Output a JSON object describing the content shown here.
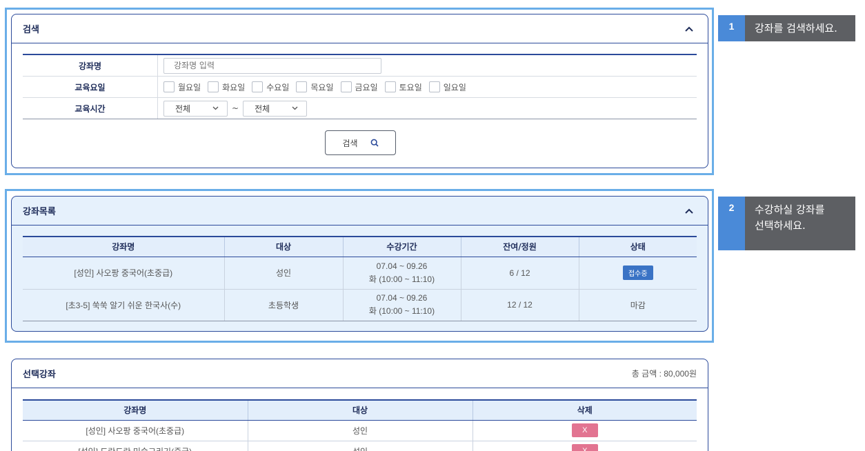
{
  "search_panel": {
    "title": "검색",
    "course_name_label": "강좌명",
    "course_name_placeholder": "강좌명 입력",
    "days_label": "교육요일",
    "days": [
      "월요일",
      "화요일",
      "수요일",
      "목요일",
      "금요일",
      "토요일",
      "일요일"
    ],
    "time_label": "교육시간",
    "time_from": "전체",
    "time_separator": "~",
    "time_to": "전체",
    "search_button": "검색"
  },
  "course_list_panel": {
    "title": "강좌목록",
    "columns": [
      "강좌명",
      "대상",
      "수강기간",
      "잔여/정원",
      "상태"
    ],
    "rows": [
      {
        "name": "[성인] 사오팡 중국어(초중급)",
        "target": "성인",
        "period_dates": "07.04 ~ 09.26",
        "period_time": "화 (10:00 ~ 11:10)",
        "seats": "6 / 12",
        "status": "접수중",
        "status_kind": "badge"
      },
      {
        "name": "[초3-5] 쑥쑥 알기 쉬운 한국사(수)",
        "target": "초등학생",
        "period_dates": "07.04 ~ 09.26",
        "period_time": "화 (10:00 ~ 11:10)",
        "seats": "12 / 12",
        "status": "마감",
        "status_kind": "text"
      }
    ]
  },
  "selected_panel": {
    "title": "선택강좌",
    "total": "총 금액 : 80,000원",
    "columns": [
      "강좌명",
      "대상",
      "삭제"
    ],
    "rows": [
      {
        "name": "[성인] 사오팡 중국어(초중급)",
        "target": "성인",
        "delete": "X"
      },
      {
        "name": "[성인] 도란도란 미술그리기(중급)",
        "target": "성인",
        "delete": "X"
      }
    ]
  },
  "steps": [
    {
      "number": "1",
      "text": "강좌를 검색하세요."
    },
    {
      "number": "2",
      "text": "수강하실 강좌를 선택하세요."
    }
  ],
  "colors": {
    "accent_highlight": "#6aaee8",
    "panel_border": "#2b4a9a",
    "badge": "#3a73c5",
    "delete": "#e27491",
    "step_number": "#4a8ad8",
    "step_bg": "#5d5f63"
  }
}
